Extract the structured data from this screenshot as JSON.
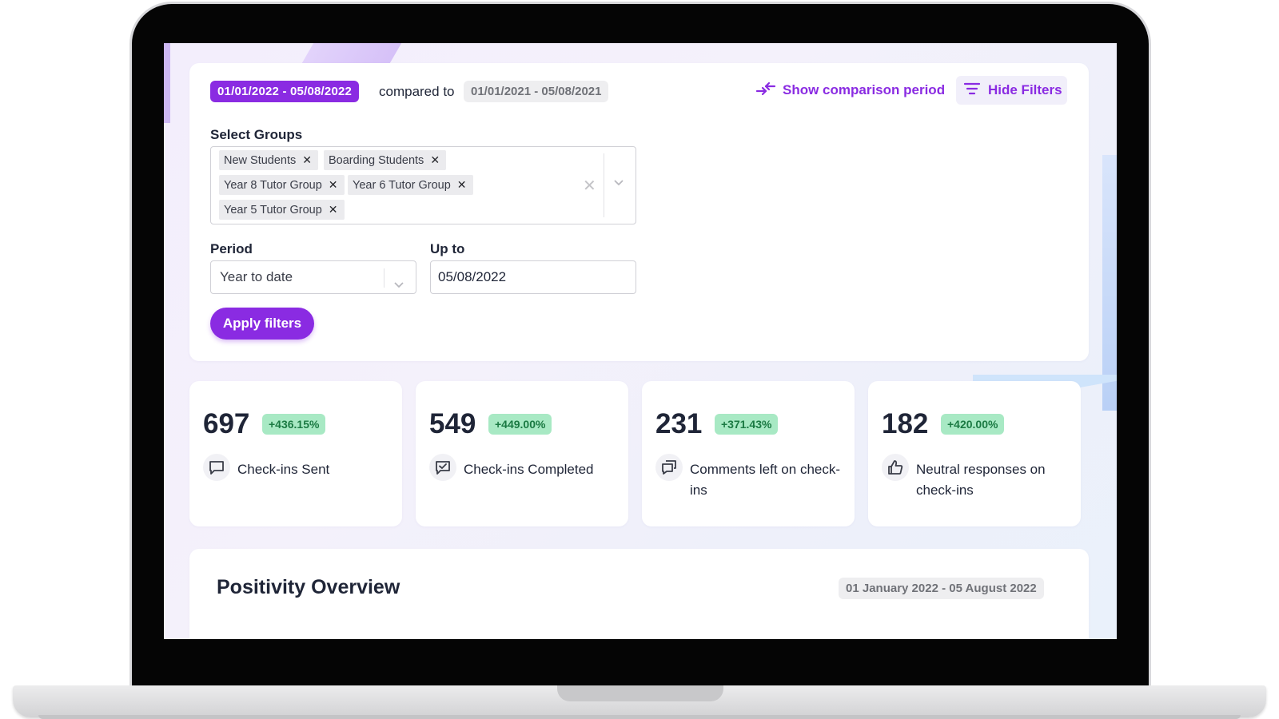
{
  "filters": {
    "date_range": "01/01/2022 - 05/08/2022",
    "compared_to_label": "compared to",
    "comparison_range": "01/01/2021 - 05/08/2021",
    "show_comparison_label": "Show comparison period",
    "hide_filters_label": "Hide Filters",
    "select_groups_label": "Select Groups",
    "groups": [
      {
        "label": "New Students"
      },
      {
        "label": "Boarding Students"
      },
      {
        "label": "Year 8 Tutor Group"
      },
      {
        "label": "Year 6 Tutor Group"
      },
      {
        "label": "Year 5 Tutor Group"
      }
    ],
    "period_label": "Period",
    "period_value": "Year to date",
    "up_to_label": "Up to",
    "up_to_value": "05/08/2022",
    "apply_label": "Apply filters"
  },
  "stats": [
    {
      "value": "697",
      "change": "+436.15%",
      "label": "Check-ins Sent",
      "icon": "message-icon"
    },
    {
      "value": "549",
      "change": "+449.00%",
      "label": "Check-ins Completed",
      "icon": "message-check-icon"
    },
    {
      "value": "231",
      "change": "+371.43%",
      "label": "Comments left on check-ins",
      "icon": "comments-icon"
    },
    {
      "value": "182",
      "change": "+420.00%",
      "label": "Neutral responses on check-ins",
      "icon": "thumbs-up-icon"
    }
  ],
  "overview": {
    "title": "Positivity Overview",
    "range": "01 January 2022 - 05 August 2022"
  },
  "colors": {
    "accent": "#8a2be2",
    "positive_badge_bg": "#a8e9c4",
    "positive_badge_text": "#1b7a43",
    "text_dark": "#1f2537"
  }
}
